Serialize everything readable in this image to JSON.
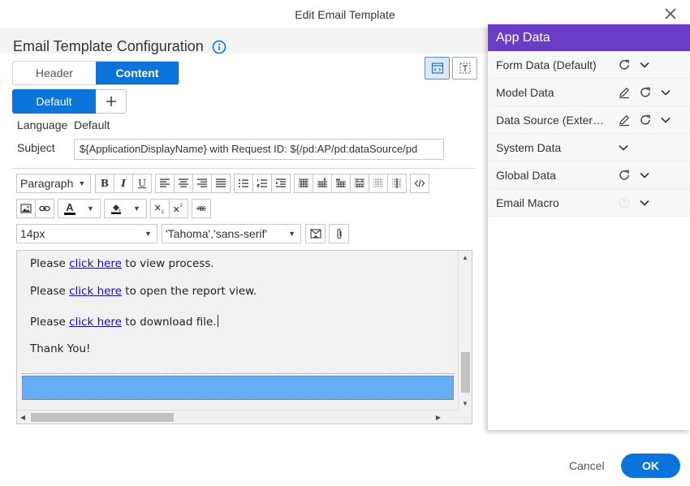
{
  "dialog": {
    "title": "Edit Email Template",
    "cancel": "Cancel",
    "ok": "OK"
  },
  "config": {
    "title": "Email Template Configuration"
  },
  "tabs": [
    {
      "label": "Header",
      "active": false
    },
    {
      "label": "Content",
      "active": true
    }
  ],
  "language_tabs": {
    "default_label": "Default",
    "add_symbol": "+"
  },
  "language": {
    "label": "Language",
    "value": "Default"
  },
  "subject": {
    "label": "Subject",
    "value": "${ApplicationDisplayName} with Request ID: ${/pd:AP/pd:dataSource/pd"
  },
  "toolbar": {
    "block_format": "Paragraph",
    "font_size": "14px",
    "font_family": "'Tahoma','sans-serif'",
    "bold": "B",
    "italic": "I",
    "underline": "U",
    "font_color_letter": "A"
  },
  "editor": {
    "paragraphs": [
      {
        "before": "Please ",
        "link": "click here",
        "after": " to view process."
      },
      {
        "before": "Please ",
        "link": "click here",
        "after": " to open the report view."
      },
      {
        "before": "Please ",
        "link": "click here",
        "after": " to download file."
      },
      {
        "text": "Thank You!"
      }
    ],
    "selection_color": "#63aef5"
  },
  "app_data": {
    "title": "App Data",
    "items": [
      {
        "label": "Form Data (Default)"
      },
      {
        "label": "Model Data"
      },
      {
        "label": "Data Source (External)"
      },
      {
        "label": "System Data"
      },
      {
        "label": "Global Data"
      },
      {
        "label": "Email Macro"
      }
    ]
  },
  "colors": {
    "primary": "#0a74da",
    "panel_header": "#6a3dc7"
  }
}
